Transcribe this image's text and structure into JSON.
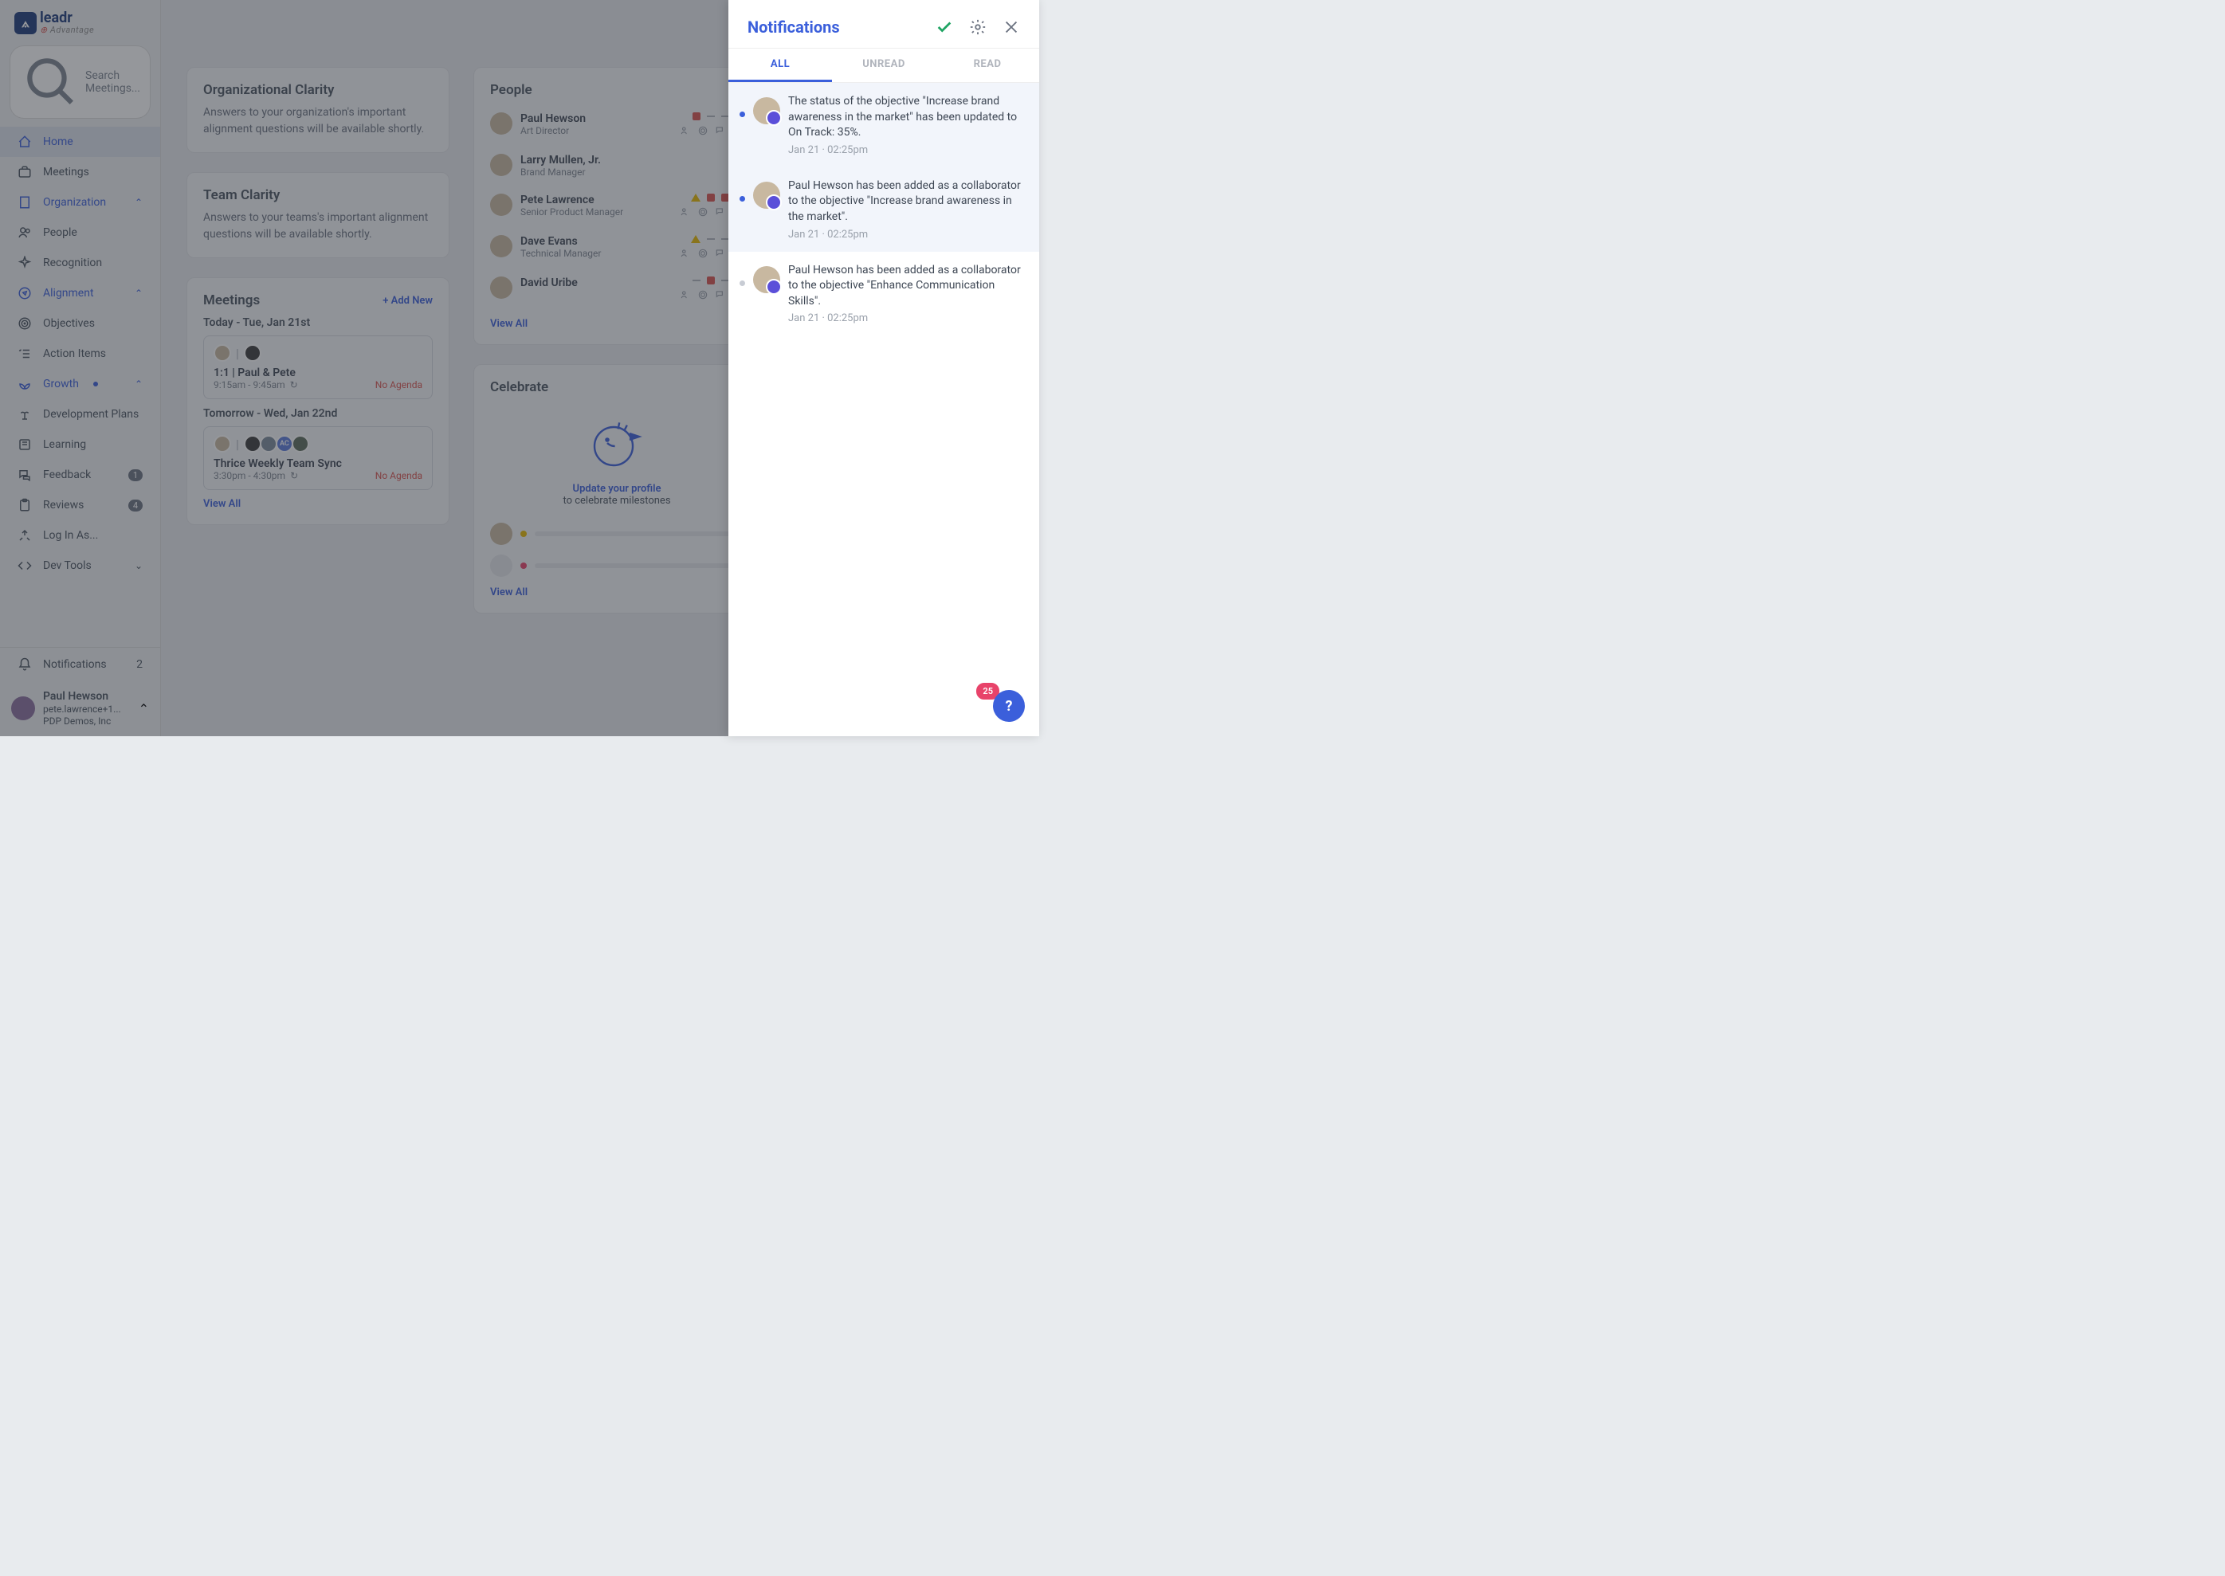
{
  "brand": {
    "name": "leadr",
    "tagline": "Advantage"
  },
  "search": {
    "placeholder": "Search Meetings..."
  },
  "nav": {
    "home": "Home",
    "meetings": "Meetings",
    "organization": "Organization",
    "people": "People",
    "recognition": "Recognition",
    "alignment": "Alignment",
    "objectives": "Objectives",
    "action_items": "Action Items",
    "growth": "Growth",
    "dev_plans": "Development Plans",
    "learning": "Learning",
    "feedback": "Feedback",
    "feedback_badge": "1",
    "reviews": "Reviews",
    "reviews_badge": "4",
    "log_in_as": "Log In As...",
    "dev_tools": "Dev Tools",
    "notifications": "Notifications",
    "notifications_badge": "2"
  },
  "user": {
    "name": "Paul Hewson",
    "email": "pete.lawrence+1...",
    "org": "PDP Demos, Inc"
  },
  "cards": {
    "org_clarity": {
      "title": "Organizational Clarity",
      "text": "Answers to your organization's important alignment questions will be available shortly."
    },
    "team_clarity": {
      "title": "Team Clarity",
      "text": "Answers to your teams's important alignment questions will be available shortly."
    }
  },
  "meetings_section": {
    "title": "Meetings",
    "add": "+ Add New",
    "today_label": "Today - Tue, Jan 21st",
    "tomorrow_label": "Tomorrow - Wed, Jan 22nd",
    "today": {
      "title": "1:1 | Paul & Pete",
      "time": "9:15am - 9:45am",
      "agenda": "No Agenda"
    },
    "tomorrow": {
      "title": "Thrice Weekly Team Sync",
      "time": "3:30pm - 4:30pm",
      "agenda": "No Agenda"
    },
    "view_all": "View All"
  },
  "people_section": {
    "title": "People",
    "items": [
      {
        "name": "Paul Hewson",
        "role": "Art Director"
      },
      {
        "name": "Larry Mullen, Jr.",
        "role": "Brand Manager"
      },
      {
        "name": "Pete Lawrence",
        "role": "Senior Product Manager"
      },
      {
        "name": "Dave Evans",
        "role": "Technical Manager"
      },
      {
        "name": "David Uribe",
        "role": ""
      }
    ],
    "view_all": "View All"
  },
  "celebrate": {
    "title": "Celebrate",
    "link": "Update your profile",
    "text": "to celebrate milestones",
    "view_all": "View All"
  },
  "notif_panel": {
    "title": "Notifications",
    "tabs": {
      "all": "ALL",
      "unread": "UNREAD",
      "read": "READ"
    },
    "items": [
      {
        "text": "The status of the objective \"Increase brand awareness in the market\" has been updated to On Track: 35%.",
        "time": "Jan 21 · 02:25pm",
        "unread": true
      },
      {
        "text": "Paul Hewson has been added as a collaborator to the objective \"Increase brand awareness in the market\".",
        "time": "Jan 21 · 02:25pm",
        "unread": true
      },
      {
        "text": "Paul Hewson has been added as a collaborator to the objective \"Enhance Communication Skills\".",
        "time": "Jan 21 · 02:25pm",
        "unread": false
      }
    ]
  },
  "help_badge": "25"
}
